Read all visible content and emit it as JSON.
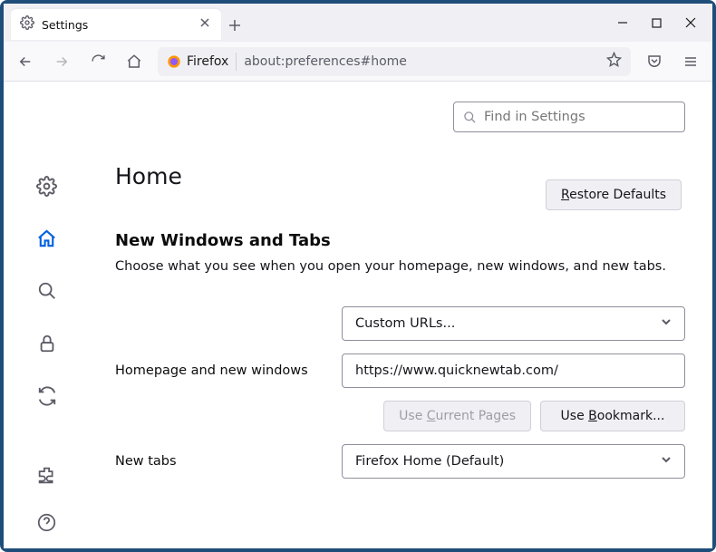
{
  "window": {
    "tab_title": "Settings",
    "tab_icon": "gear-icon"
  },
  "toolbar": {
    "identity_label": "Firefox",
    "url": "about:preferences#home"
  },
  "search": {
    "placeholder": "Find in Settings"
  },
  "page": {
    "title": "Home",
    "restore_defaults_pre": "R",
    "restore_defaults_rest": "estore Defaults",
    "section_title": "New Windows and Tabs",
    "section_desc": "Choose what you see when you open your homepage, new windows, and new tabs."
  },
  "form": {
    "homepage_label": "Homepage and new windows",
    "homepage_select": "Custom URLs...",
    "homepage_url_value": "https://www.quicknewtab.com/",
    "use_current_pre": "Use ",
    "use_current_u": "C",
    "use_current_rest": "urrent Pages",
    "use_bookmark_pre": "Use ",
    "use_bookmark_u": "B",
    "use_bookmark_rest": "ookmark...",
    "newtabs_label": "New tabs",
    "newtabs_select": "Firefox Home (Default)"
  }
}
